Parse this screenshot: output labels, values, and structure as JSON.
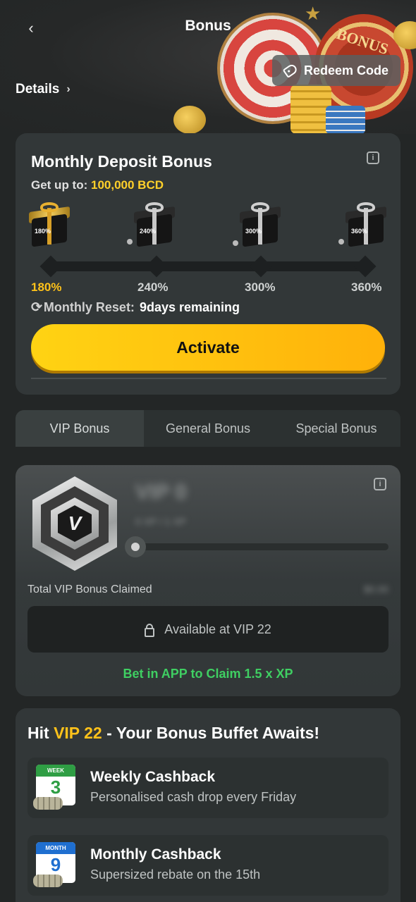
{
  "header": {
    "title": "Bonus",
    "details_label": "Details",
    "redeem_label": "Redeem Code",
    "banner_text": "BONUS"
  },
  "deposit": {
    "title": "Monthly Deposit Bonus",
    "get_up_label": "Get up to:",
    "get_up_value": "100,000 BCD",
    "milestones": [
      {
        "percent": "180%",
        "gift_label": "180%",
        "active": true
      },
      {
        "percent": "240%",
        "gift_label": "240%",
        "active": false
      },
      {
        "percent": "300%",
        "gift_label": "300%",
        "active": false
      },
      {
        "percent": "360%",
        "gift_label": "360%",
        "active": false
      }
    ],
    "reset_label": "Monthly Reset:",
    "reset_value": "9days remaining",
    "activate_label": "Activate"
  },
  "tabs": [
    {
      "label": "VIP Bonus",
      "active": true
    },
    {
      "label": "General Bonus",
      "active": false
    },
    {
      "label": "Special Bonus",
      "active": false
    }
  ],
  "vip": {
    "level": "VIP 0",
    "xp": "0 XP / 1 XP",
    "badge_letter": "V",
    "total_label": "Total VIP Bonus Claimed",
    "total_value": "$0.00",
    "available_label": "Available at VIP 22",
    "bet_app": "Bet in APP to Claim 1.5 x XP"
  },
  "perks": {
    "title_prefix": "Hit",
    "title_highlight": "VIP 22",
    "title_suffix": "- Your Bonus Buffet Awaits!",
    "items": [
      {
        "cal_head": "WEEK",
        "cal_num": "3",
        "cal_color": "#2f9e44",
        "title": "Weekly Cashback",
        "desc": "Personalised cash drop every Friday"
      },
      {
        "cal_head": "MONTH",
        "cal_num": "9",
        "cal_color": "#1f6fd0",
        "title": "Monthly Cashback",
        "desc": "Supersized rebate on the 15th"
      }
    ]
  },
  "colors": {
    "accent": "#ffc21a",
    "green": "#3fcf62",
    "background": "#232626",
    "card": "#323738"
  }
}
